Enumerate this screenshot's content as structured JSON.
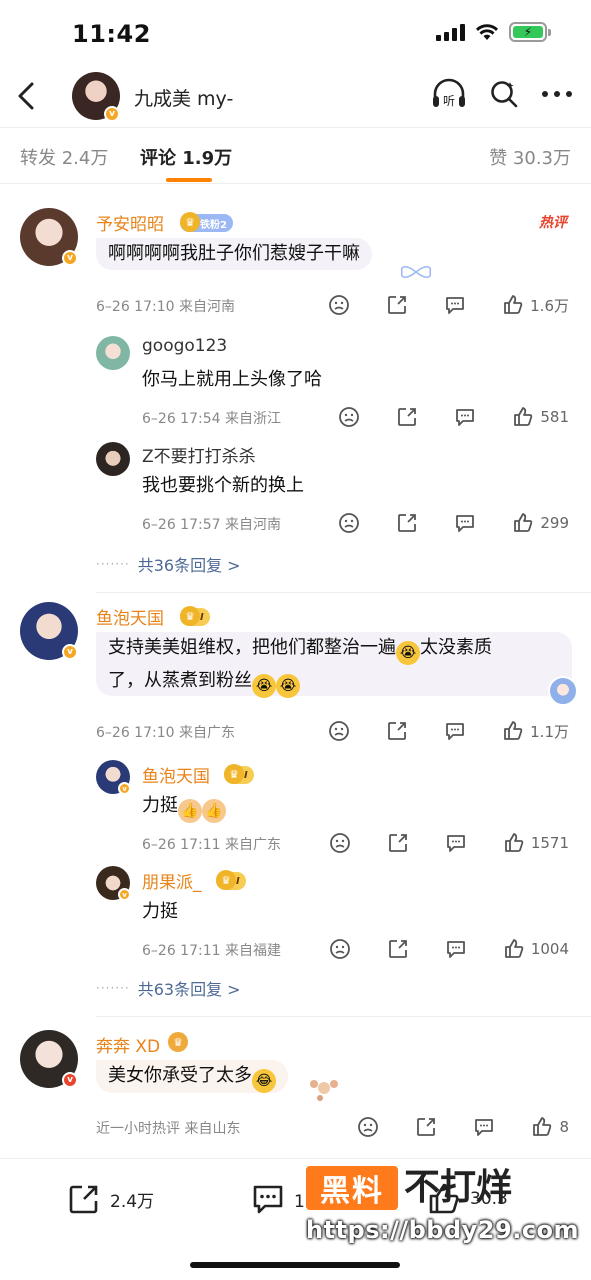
{
  "status_bar": {
    "time": "11:42"
  },
  "header": {
    "account_name": "九成美 my-",
    "back_label": "back"
  },
  "tabs": {
    "forward": "转发 2.4万",
    "comments": "评论 1.9万",
    "likes": "赞 30.3万"
  },
  "comments": [
    {
      "user": "予安昭昭",
      "badge": "铁粉2",
      "hot_tag": "热评",
      "text": "啊啊啊啊我肚子你们惹嫂子干嘛",
      "meta": "6–26 17:10  来自河南",
      "likes": "1.6万",
      "replies": [
        {
          "user": "googo123",
          "text": "你马上就用上头像了哈",
          "meta": "6–26 17:54  来自浙江",
          "likes": "581"
        },
        {
          "user": "Z不要打打杀杀",
          "text": "我也要挑个新的换上",
          "meta": "6–26 17:57  来自河南",
          "likes": "299"
        }
      ],
      "more_replies": "共36条回复 >"
    },
    {
      "user": "鱼泡天国",
      "badge": "I",
      "text_line1": "支持美美姐维权，把他们都整治一遍",
      "text_line1_tail": "太没素质",
      "text_line2": "了，从蒸煮到粉丝",
      "meta": "6–26 17:10  来自广东",
      "likes": "1.1万",
      "replies": [
        {
          "user": "鱼泡天国",
          "badge": "I",
          "text": "力挺",
          "meta": "6–26 17:11  来自广东",
          "likes": "1571"
        },
        {
          "user": "朋果派_",
          "badge": "I",
          "text": "力挺",
          "meta": "6–26 17:11  来自福建",
          "likes": "1004"
        }
      ],
      "more_replies": "共63条回复 >"
    },
    {
      "user": "奔奔 XD",
      "text": "美女你承受了太多",
      "meta": "近一小时热评  来自山东",
      "likes": "8"
    }
  ],
  "bottom_bar": {
    "forward_count": "2.4万",
    "comment_count": "1.9万",
    "like_count": "30.3"
  },
  "watermark": {
    "brand": "黑料",
    "slogan": "不打烊",
    "url": "https://bbdy29.com"
  },
  "colors": {
    "accent": "#ff8200",
    "username": "#e8841a",
    "link": "#4e6a96"
  }
}
